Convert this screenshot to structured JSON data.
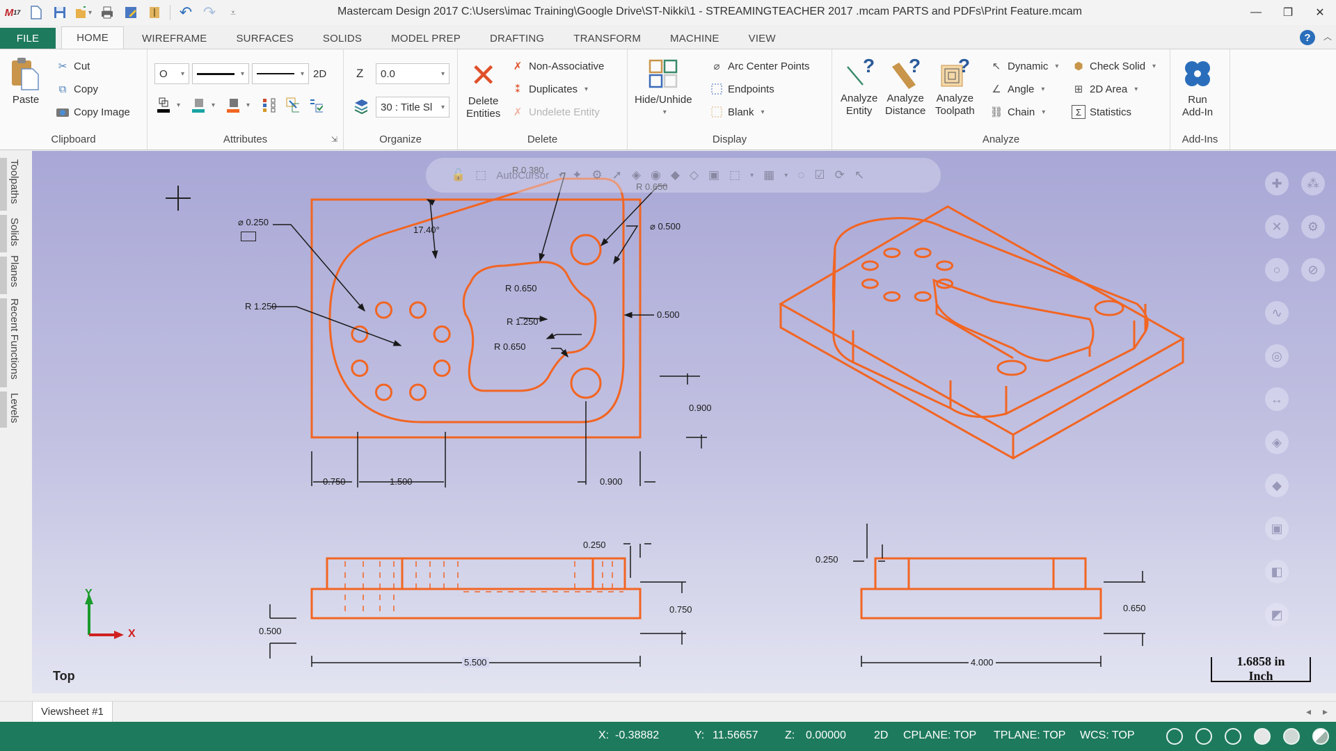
{
  "app": {
    "title": "Mastercam Design 2017  C:\\Users\\imac Training\\Google Drive\\ST-Nikki\\1 - STREAMINGTEACHER 2017 .mcam PARTS and PDFs\\Print Feature.mcam",
    "logo_text": "17",
    "window_controls": [
      "minimize",
      "restore",
      "close"
    ]
  },
  "quick_access": [
    {
      "name": "new-file-icon",
      "glyph": "🗋"
    },
    {
      "name": "save-icon",
      "glyph": "💾"
    },
    {
      "name": "open-icon",
      "glyph": "📂"
    },
    {
      "name": "print-icon",
      "glyph": "🖶"
    },
    {
      "name": "save-as-icon",
      "glyph": "✎"
    },
    {
      "name": "zip2go-icon",
      "glyph": "🗀"
    },
    {
      "name": "undo-icon",
      "glyph": "↶"
    },
    {
      "name": "redo-icon",
      "glyph": "↷"
    },
    {
      "name": "customize-qat-icon",
      "glyph": "⋮"
    }
  ],
  "tabs": [
    {
      "label": "FILE"
    },
    {
      "label": "HOME",
      "active": true
    },
    {
      "label": "WIREFRAME"
    },
    {
      "label": "SURFACES"
    },
    {
      "label": "SOLIDS"
    },
    {
      "label": "MODEL PREP"
    },
    {
      "label": "DRAFTING"
    },
    {
      "label": "TRANSFORM"
    },
    {
      "label": "MACHINE"
    },
    {
      "label": "VIEW"
    }
  ],
  "ribbon": {
    "clipboard": {
      "label": "Clipboard",
      "paste": "Paste",
      "cut": "Cut",
      "copy": "Copy",
      "copy_image": "Copy Image"
    },
    "attributes": {
      "label": "Attributes",
      "point_style": "O",
      "line_mode": "2D"
    },
    "organize": {
      "label": "Organize",
      "z_label": "Z",
      "z_value": "0.0",
      "level_value": "30 : Title Sl"
    },
    "delete": {
      "label": "Delete",
      "delete_entities": [
        "Delete",
        "Entities"
      ],
      "non_associative": "Non-Associative",
      "duplicates": "Duplicates",
      "undelete_entity": "Undelete Entity"
    },
    "display": {
      "label": "Display",
      "hide_unhide": "Hide/Unhide",
      "arc_center_points": "Arc Center Points",
      "endpoints": "Endpoints",
      "blank": "Blank"
    },
    "analyze": {
      "label": "Analyze",
      "analyze_entity": [
        "Analyze",
        "Entity"
      ],
      "analyze_distance": [
        "Analyze",
        "Distance"
      ],
      "analyze_toolpath": [
        "Analyze",
        "Toolpath"
      ],
      "dynamic": "Dynamic",
      "angle": "Angle",
      "chain": "Chain",
      "check_solid": "Check Solid",
      "area_2d": "2D Area",
      "statistics": "Statistics"
    },
    "addins": {
      "label": "Add-Ins",
      "run_addin": [
        "Run",
        "Add-In"
      ]
    }
  },
  "left_dock": [
    "Toolpaths",
    "Solids",
    "Planes",
    "Recent Functions",
    "Levels"
  ],
  "graphics": {
    "floatbar_text": "AutoCursor",
    "view_name": "Top",
    "axis_x": "X",
    "axis_y": "Y",
    "scale_value": "1.6858 in",
    "scale_unit": "Inch",
    "colors": {
      "geometry": "#f26522",
      "dimension": "#1a1a1a",
      "axis": "#1a9a2a",
      "axis_x": "#d02020"
    },
    "dimensions": {
      "dia_small_holes": "⌀ 0.250",
      "angle": "17.40°",
      "r_0380": "R 0.380",
      "r_0650_top": "R 0.650",
      "dia_large_hole": "⌀ 0.500",
      "r_1250_left": "R 1.250",
      "r_0650_pocket_top": "R 0.650",
      "r_1250_pocket": "R 1.250",
      "r_0650_pocket_bottom": "R 0.650",
      "width_0500": "0.500",
      "height_0900": "0.900",
      "dim_0750": "0.750",
      "dim_1500": "1.500",
      "dim_0900": "0.900",
      "front_0250": "0.250",
      "front_0750": "0.750",
      "front_0500": "0.500",
      "front_5500": "5.500",
      "side_0250": "0.250",
      "side_0650": "0.650",
      "side_4000": "4.000"
    }
  },
  "viewsheet": {
    "tab": "Viewsheet #1"
  },
  "status": {
    "x_label": "X:",
    "x_value": "-0.38882",
    "y_label": "Y:",
    "y_value": "11.56657",
    "z_label": "Z:",
    "z_value": "0.00000",
    "mode": "2D",
    "cplane": "CPLANE: TOP",
    "tplane": "TPLANE: TOP",
    "wcs": "WCS: TOP"
  }
}
